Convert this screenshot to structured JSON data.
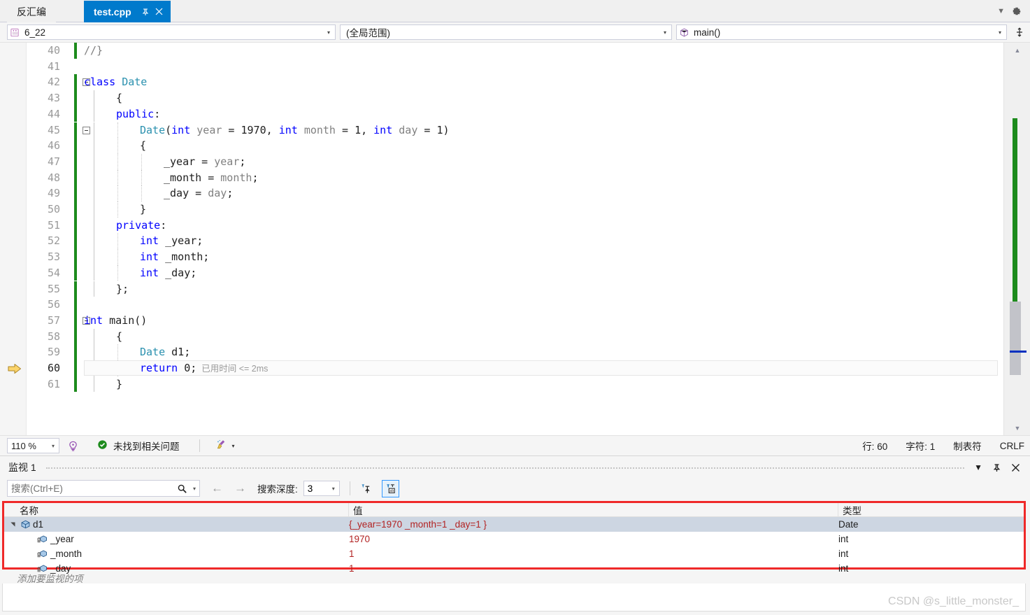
{
  "window": {
    "tabs": [
      {
        "label": "反汇编",
        "active": false,
        "name": "tab-disassembly"
      },
      {
        "label": "test.cpp",
        "active": true,
        "name": "tab-test-cpp"
      }
    ],
    "tab_pin_icon": "pin-icon",
    "tab_close_icon": "close-icon",
    "tabstrip_dropdown_icon": "chevron-down-icon",
    "tabstrip_settings_icon": "gear-icon"
  },
  "navbar": {
    "project": {
      "value": "6_22",
      "icon": "cpp-project-icon",
      "caret": "▾"
    },
    "scope": {
      "value": "(全局范围)",
      "icon": "",
      "caret": "▾"
    },
    "member": {
      "value": "main()",
      "icon": "method-cube-icon",
      "caret": "▾"
    },
    "splitter_icon": "split-window-icon"
  },
  "editor": {
    "current_line": 60,
    "step_arrow_icon": "step-arrow-icon",
    "elapsed_time": "已用时间 <= 2ms",
    "lines": [
      {
        "n": 40,
        "changed": true,
        "fold": false,
        "tokens": [
          {
            "t": "//}",
            "c": "cmt"
          }
        ],
        "indent": 0,
        "guides": []
      },
      {
        "n": 41,
        "changed": false,
        "fold": false,
        "tokens": [],
        "indent": 0,
        "guides": []
      },
      {
        "n": 42,
        "changed": true,
        "fold": true,
        "tokens": [
          {
            "t": "class ",
            "c": "kw"
          },
          {
            "t": "Date",
            "c": "type"
          }
        ],
        "indent": 0,
        "guides": []
      },
      {
        "n": 43,
        "changed": true,
        "fold": false,
        "tokens": [
          {
            "t": "{",
            "c": "plain"
          }
        ],
        "indent": 1,
        "guides": []
      },
      {
        "n": 44,
        "changed": true,
        "fold": false,
        "tokens": [
          {
            "t": "public",
            "c": "kw"
          },
          {
            "t": ":",
            "c": "plain"
          }
        ],
        "indent": 1,
        "guides": []
      },
      {
        "n": 45,
        "changed": true,
        "fold": true,
        "tokens": [
          {
            "t": "Date",
            "c": "type"
          },
          {
            "t": "(",
            "c": "plain"
          },
          {
            "t": "int ",
            "c": "kw"
          },
          {
            "t": "year",
            "c": "param"
          },
          {
            "t": " = ",
            "c": "plain"
          },
          {
            "t": "1970",
            "c": "num"
          },
          {
            "t": ", ",
            "c": "plain"
          },
          {
            "t": "int ",
            "c": "kw"
          },
          {
            "t": "month",
            "c": "param"
          },
          {
            "t": " = ",
            "c": "plain"
          },
          {
            "t": "1",
            "c": "num"
          },
          {
            "t": ", ",
            "c": "plain"
          },
          {
            "t": "int ",
            "c": "kw"
          },
          {
            "t": "day",
            "c": "param"
          },
          {
            "t": " = ",
            "c": "plain"
          },
          {
            "t": "1",
            "c": "num"
          },
          {
            "t": ")",
            "c": "plain"
          }
        ],
        "indent": 2,
        "guides": []
      },
      {
        "n": 46,
        "changed": true,
        "fold": false,
        "tokens": [
          {
            "t": "{",
            "c": "plain"
          }
        ],
        "indent": 2,
        "guides": []
      },
      {
        "n": 47,
        "changed": true,
        "fold": false,
        "tokens": [
          {
            "t": "_year",
            "c": "plain"
          },
          {
            "t": " = ",
            "c": "plain"
          },
          {
            "t": "year",
            "c": "param"
          },
          {
            "t": ";",
            "c": "plain"
          }
        ],
        "indent": 3,
        "guides": []
      },
      {
        "n": 48,
        "changed": true,
        "fold": false,
        "tokens": [
          {
            "t": "_month",
            "c": "plain"
          },
          {
            "t": " = ",
            "c": "plain"
          },
          {
            "t": "month",
            "c": "param"
          },
          {
            "t": ";",
            "c": "plain"
          }
        ],
        "indent": 3,
        "guides": []
      },
      {
        "n": 49,
        "changed": true,
        "fold": false,
        "tokens": [
          {
            "t": "_day",
            "c": "plain"
          },
          {
            "t": " = ",
            "c": "plain"
          },
          {
            "t": "day",
            "c": "param"
          },
          {
            "t": ";",
            "c": "plain"
          }
        ],
        "indent": 3,
        "guides": []
      },
      {
        "n": 50,
        "changed": true,
        "fold": false,
        "tokens": [
          {
            "t": "}",
            "c": "plain"
          }
        ],
        "indent": 2,
        "guides": []
      },
      {
        "n": 51,
        "changed": true,
        "fold": false,
        "tokens": [
          {
            "t": "private",
            "c": "kw"
          },
          {
            "t": ":",
            "c": "plain"
          }
        ],
        "indent": 1,
        "guides": []
      },
      {
        "n": 52,
        "changed": true,
        "fold": false,
        "tokens": [
          {
            "t": "int ",
            "c": "kw"
          },
          {
            "t": "_year;",
            "c": "plain"
          }
        ],
        "indent": 2,
        "guides": []
      },
      {
        "n": 53,
        "changed": true,
        "fold": false,
        "tokens": [
          {
            "t": "int ",
            "c": "kw"
          },
          {
            "t": "_month;",
            "c": "plain"
          }
        ],
        "indent": 2,
        "guides": []
      },
      {
        "n": 54,
        "changed": true,
        "fold": false,
        "tokens": [
          {
            "t": "int ",
            "c": "kw"
          },
          {
            "t": "_day;",
            "c": "plain"
          }
        ],
        "indent": 2,
        "guides": []
      },
      {
        "n": 55,
        "changed": true,
        "fold": false,
        "tokens": [
          {
            "t": "};",
            "c": "plain"
          }
        ],
        "indent": 1,
        "guides": []
      },
      {
        "n": 56,
        "changed": true,
        "fold": false,
        "tokens": [],
        "indent": 0,
        "guides": []
      },
      {
        "n": 57,
        "changed": true,
        "fold": true,
        "tokens": [
          {
            "t": "int ",
            "c": "kw"
          },
          {
            "t": "main",
            "c": "plain"
          },
          {
            "t": "()",
            "c": "plain"
          }
        ],
        "indent": 0,
        "guides": []
      },
      {
        "n": 58,
        "changed": true,
        "fold": false,
        "tokens": [
          {
            "t": "{",
            "c": "plain"
          }
        ],
        "indent": 1,
        "guides": []
      },
      {
        "n": 59,
        "changed": true,
        "fold": false,
        "tokens": [
          {
            "t": "Date",
            "c": "type"
          },
          {
            "t": " d1;",
            "c": "plain"
          }
        ],
        "indent": 2,
        "guides": []
      },
      {
        "n": 60,
        "changed": true,
        "fold": false,
        "current": true,
        "tokens": [
          {
            "t": "return",
            "c": "kw"
          },
          {
            "t": " 0;",
            "c": "plain"
          }
        ],
        "indent": 2,
        "guides": []
      },
      {
        "n": 61,
        "changed": true,
        "fold": false,
        "tokens": [
          {
            "t": "}",
            "c": "plain"
          }
        ],
        "indent": 1,
        "guides": []
      }
    ],
    "scroll_up_icon": "scroll-up-arrow-icon",
    "scroll_down_icon": "scroll-down-arrow-icon"
  },
  "statusbar": {
    "zoom": "110 %",
    "zoom_caret": "▾",
    "intellicode_icon": "intellicode-icon",
    "issues_icon": "check-circle-icon",
    "issues_text": "未找到相关问题",
    "broom_icon": "code-cleanup-broom-icon",
    "broom_caret": "▾",
    "line_label": "行: 60",
    "char_label": "字符: 1",
    "tab_label": "制表符",
    "eol_label": "CRLF"
  },
  "watch": {
    "title": "监视 1",
    "header_dropdown_icon": "chevron-down-icon",
    "header_pin_icon": "pin-icon",
    "header_close_icon": "close-icon",
    "search_placeholder": "搜索(Ctrl+E)",
    "search_value": "",
    "search_icon": "search-magnifier-icon",
    "search_caret": "▾",
    "back_icon": "arrow-left-icon",
    "forward_icon": "arrow-right-icon",
    "depth_label": "搜索深度:",
    "depth_value": "3",
    "depth_caret": "▾",
    "pin_tool_icon": "pin-filter-icon",
    "hex_tool_icon": "show-raw-values-icon",
    "highlight_color": "#ef2929",
    "columns": [
      "名称",
      "值",
      "类型"
    ],
    "rows": [
      {
        "name": "d1",
        "value": "{_year=1970 _month=1 _day=1 }",
        "type": "Date",
        "depth": 0,
        "expanded": true,
        "selected": true,
        "icon": "object-box-icon"
      },
      {
        "name": "_year",
        "value": "1970",
        "type": "int",
        "depth": 1,
        "expanded": false,
        "selected": false,
        "icon": "private-field-icon"
      },
      {
        "name": "_month",
        "value": "1",
        "type": "int",
        "depth": 1,
        "expanded": false,
        "selected": false,
        "icon": "private-field-icon"
      },
      {
        "name": "_day",
        "value": "1",
        "type": "int",
        "depth": 1,
        "expanded": false,
        "selected": false,
        "icon": "private-field-icon"
      }
    ],
    "add_watch_placeholder": "添加要监视的项"
  },
  "watermark": "CSDN @s_little_monster_"
}
